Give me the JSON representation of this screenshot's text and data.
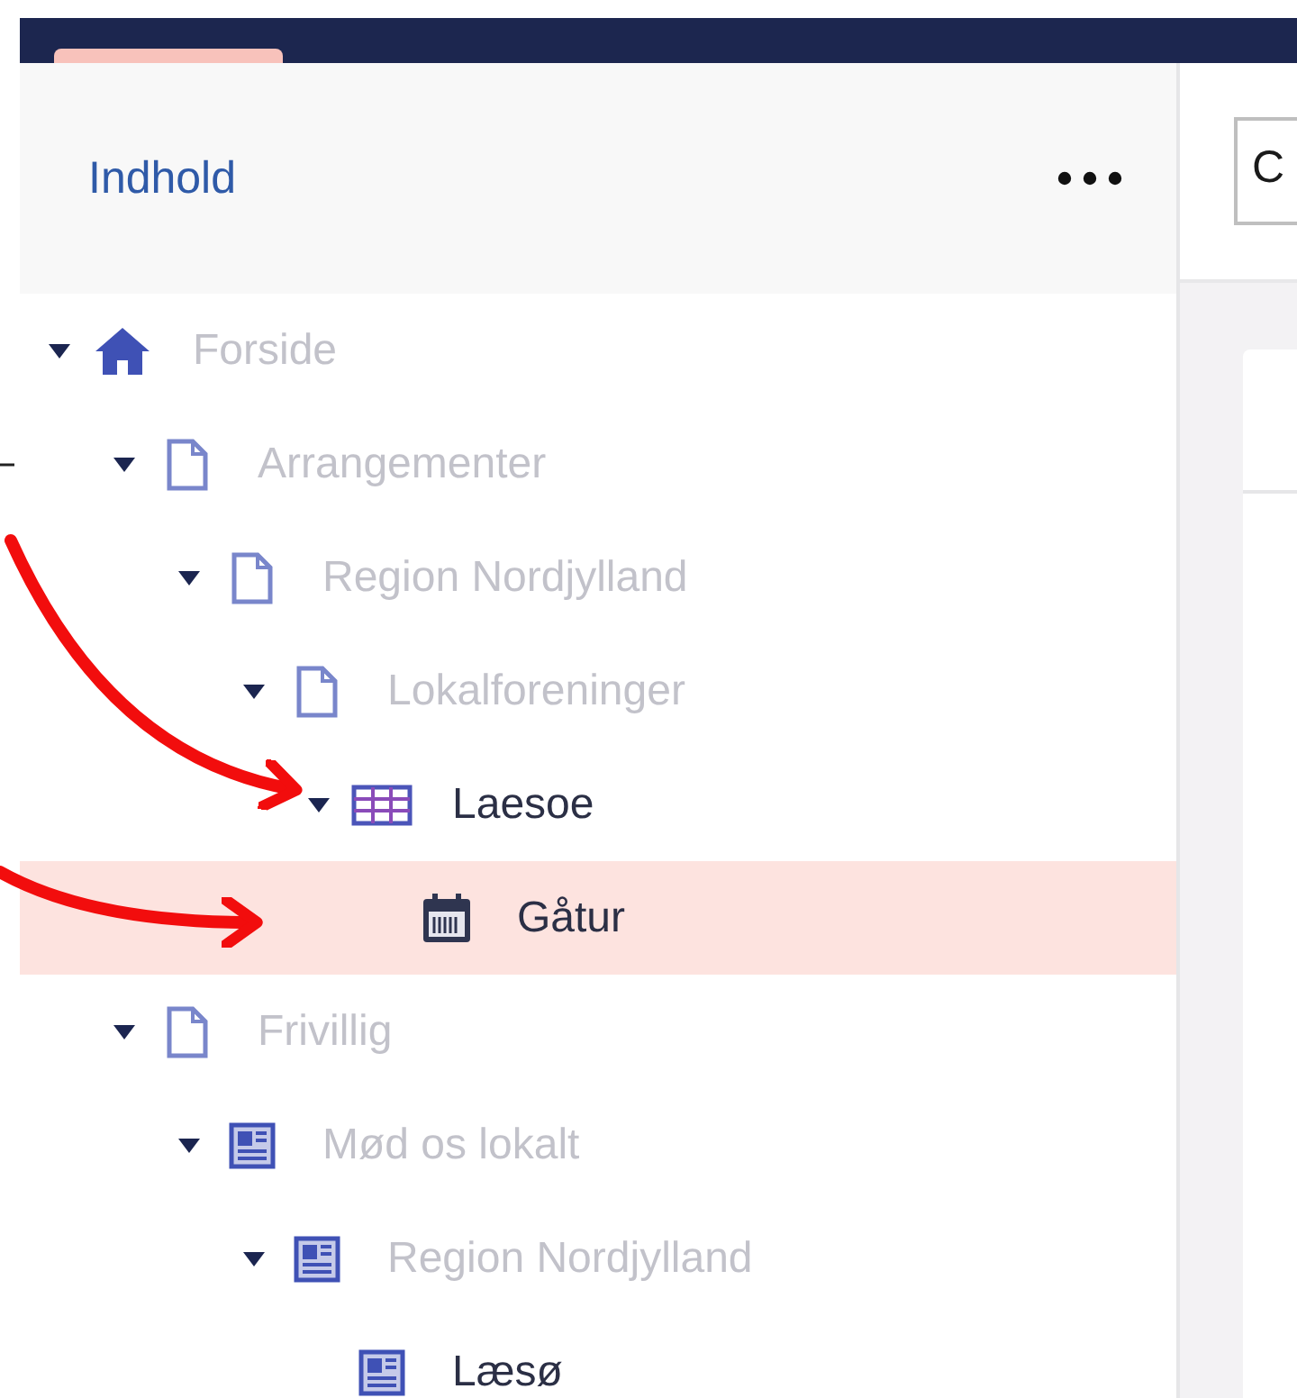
{
  "sidebar": {
    "title": "Indhold",
    "tree": [
      {
        "label": "Forside",
        "kind": "home",
        "dimmed": true,
        "selected": false,
        "expanded": true,
        "children": [
          {
            "label": "Arrangementer",
            "kind": "document",
            "dimmed": true,
            "selected": false,
            "expanded": true,
            "children": [
              {
                "label": "Region Nordjylland",
                "kind": "document",
                "dimmed": true,
                "selected": false,
                "expanded": true,
                "children": [
                  {
                    "label": "Lokalforeninger",
                    "kind": "document",
                    "dimmed": true,
                    "selected": false,
                    "expanded": true,
                    "children": [
                      {
                        "label": "Laesoe",
                        "kind": "table",
                        "dimmed": false,
                        "selected": false,
                        "expanded": true,
                        "children": [
                          {
                            "label": "Gåtur",
                            "kind": "calendar",
                            "dimmed": false,
                            "selected": true
                          }
                        ]
                      }
                    ]
                  }
                ]
              }
            ]
          },
          {
            "label": "Frivillig",
            "kind": "document",
            "dimmed": true,
            "selected": false,
            "expanded": true,
            "children": [
              {
                "label": "Mød os lokalt",
                "kind": "article",
                "dimmed": true,
                "selected": false,
                "expanded": true,
                "children": [
                  {
                    "label": "Region Nordjylland",
                    "kind": "article",
                    "dimmed": true,
                    "selected": false,
                    "expanded": true,
                    "children": [
                      {
                        "label": "Læsø",
                        "kind": "article",
                        "dimmed": false,
                        "selected": false
                      }
                    ]
                  }
                ]
              }
            ]
          }
        ]
      }
    ]
  },
  "editor": {
    "field_value": "C"
  }
}
